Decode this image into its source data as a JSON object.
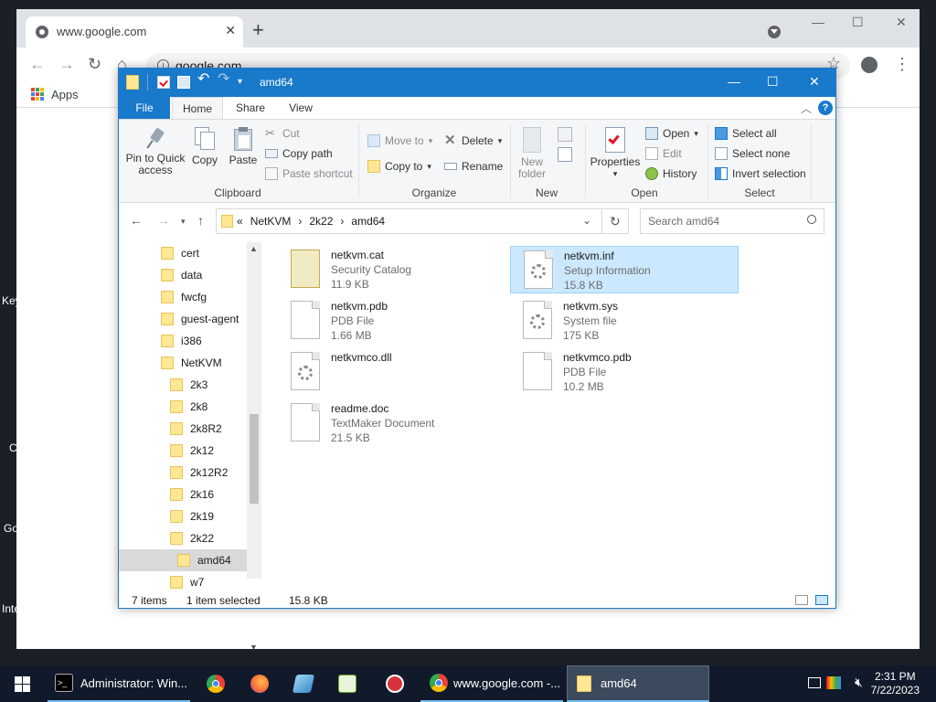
{
  "desktop": {
    "edge_texts": [
      "Key",
      "C",
      "Go",
      "Inte"
    ]
  },
  "browser": {
    "tab_title": "www.google.com",
    "address": "google.com",
    "bookmarks": {
      "apps_label": "Apps"
    }
  },
  "explorer": {
    "title": "amd64",
    "tabs": {
      "file": "File",
      "home": "Home",
      "share": "Share",
      "view": "View"
    },
    "ribbon": {
      "clipboard": {
        "label": "Clipboard",
        "pin": "Pin to Quick access",
        "copy": "Copy",
        "paste": "Paste",
        "cut": "Cut",
        "copy_path": "Copy path",
        "paste_shortcut": "Paste shortcut"
      },
      "organize": {
        "label": "Organize",
        "move_to": "Move to",
        "copy_to": "Copy to",
        "delete": "Delete",
        "rename": "Rename"
      },
      "new": {
        "label": "New",
        "new_folder": "New folder"
      },
      "open": {
        "label": "Open",
        "properties": "Properties",
        "open": "Open",
        "edit": "Edit",
        "history": "History"
      },
      "select": {
        "label": "Select",
        "select_all": "Select all",
        "select_none": "Select none",
        "invert": "Invert selection"
      }
    },
    "address": {
      "overflow": "«",
      "crumbs": [
        "NetKVM",
        "2k22",
        "amd64"
      ],
      "search_placeholder": "Search amd64"
    },
    "nav_items": [
      {
        "label": "cert",
        "level": 0
      },
      {
        "label": "data",
        "level": 0
      },
      {
        "label": "fwcfg",
        "level": 0
      },
      {
        "label": "guest-agent",
        "level": 0
      },
      {
        "label": "i386",
        "level": 0
      },
      {
        "label": "NetKVM",
        "level": 0
      },
      {
        "label": "2k3",
        "level": 1
      },
      {
        "label": "2k8",
        "level": 1
      },
      {
        "label": "2k8R2",
        "level": 1
      },
      {
        "label": "2k12",
        "level": 1
      },
      {
        "label": "2k12R2",
        "level": 1
      },
      {
        "label": "2k16",
        "level": 1
      },
      {
        "label": "2k19",
        "level": 1
      },
      {
        "label": "2k22",
        "level": 1
      },
      {
        "label": "amd64",
        "level": 2,
        "selected": true
      },
      {
        "label": "w7",
        "level": 1
      }
    ],
    "files": [
      {
        "name": "netkvm.cat",
        "type": "Security Catalog",
        "size": "11.9 KB",
        "icon": "catalog-icon"
      },
      {
        "name": "netkvm.inf",
        "type": "Setup Information",
        "size": "15.8 KB",
        "icon": "setup-info-icon",
        "selected": true
      },
      {
        "name": "netkvm.pdb",
        "type": "PDB File",
        "size": "1.66 MB",
        "icon": "generic-file-icon"
      },
      {
        "name": "netkvm.sys",
        "type": "System file",
        "size": "175 KB",
        "icon": "system-file-icon"
      },
      {
        "name": "netkvmco.dll",
        "type": "",
        "size": "",
        "icon": "dll-file-icon"
      },
      {
        "name": "netkvmco.pdb",
        "type": "PDB File",
        "size": "10.2 MB",
        "icon": "generic-file-icon"
      },
      {
        "name": "readme.doc",
        "type": "TextMaker Document",
        "size": "21.5 KB",
        "icon": "doc-file-icon"
      }
    ],
    "status": {
      "count": "7 items",
      "selection": "1 item selected",
      "size": "15.8 KB"
    }
  },
  "taskbar": {
    "items": [
      {
        "label": "Administrator: Win...",
        "icon": "terminal-icon"
      },
      {
        "label": "www.google.com -...",
        "icon": "chrome-icon"
      },
      {
        "label": "amd64",
        "icon": "folder-icon"
      }
    ],
    "clock": {
      "time": "2:31 PM",
      "date": "7/22/2023"
    }
  }
}
